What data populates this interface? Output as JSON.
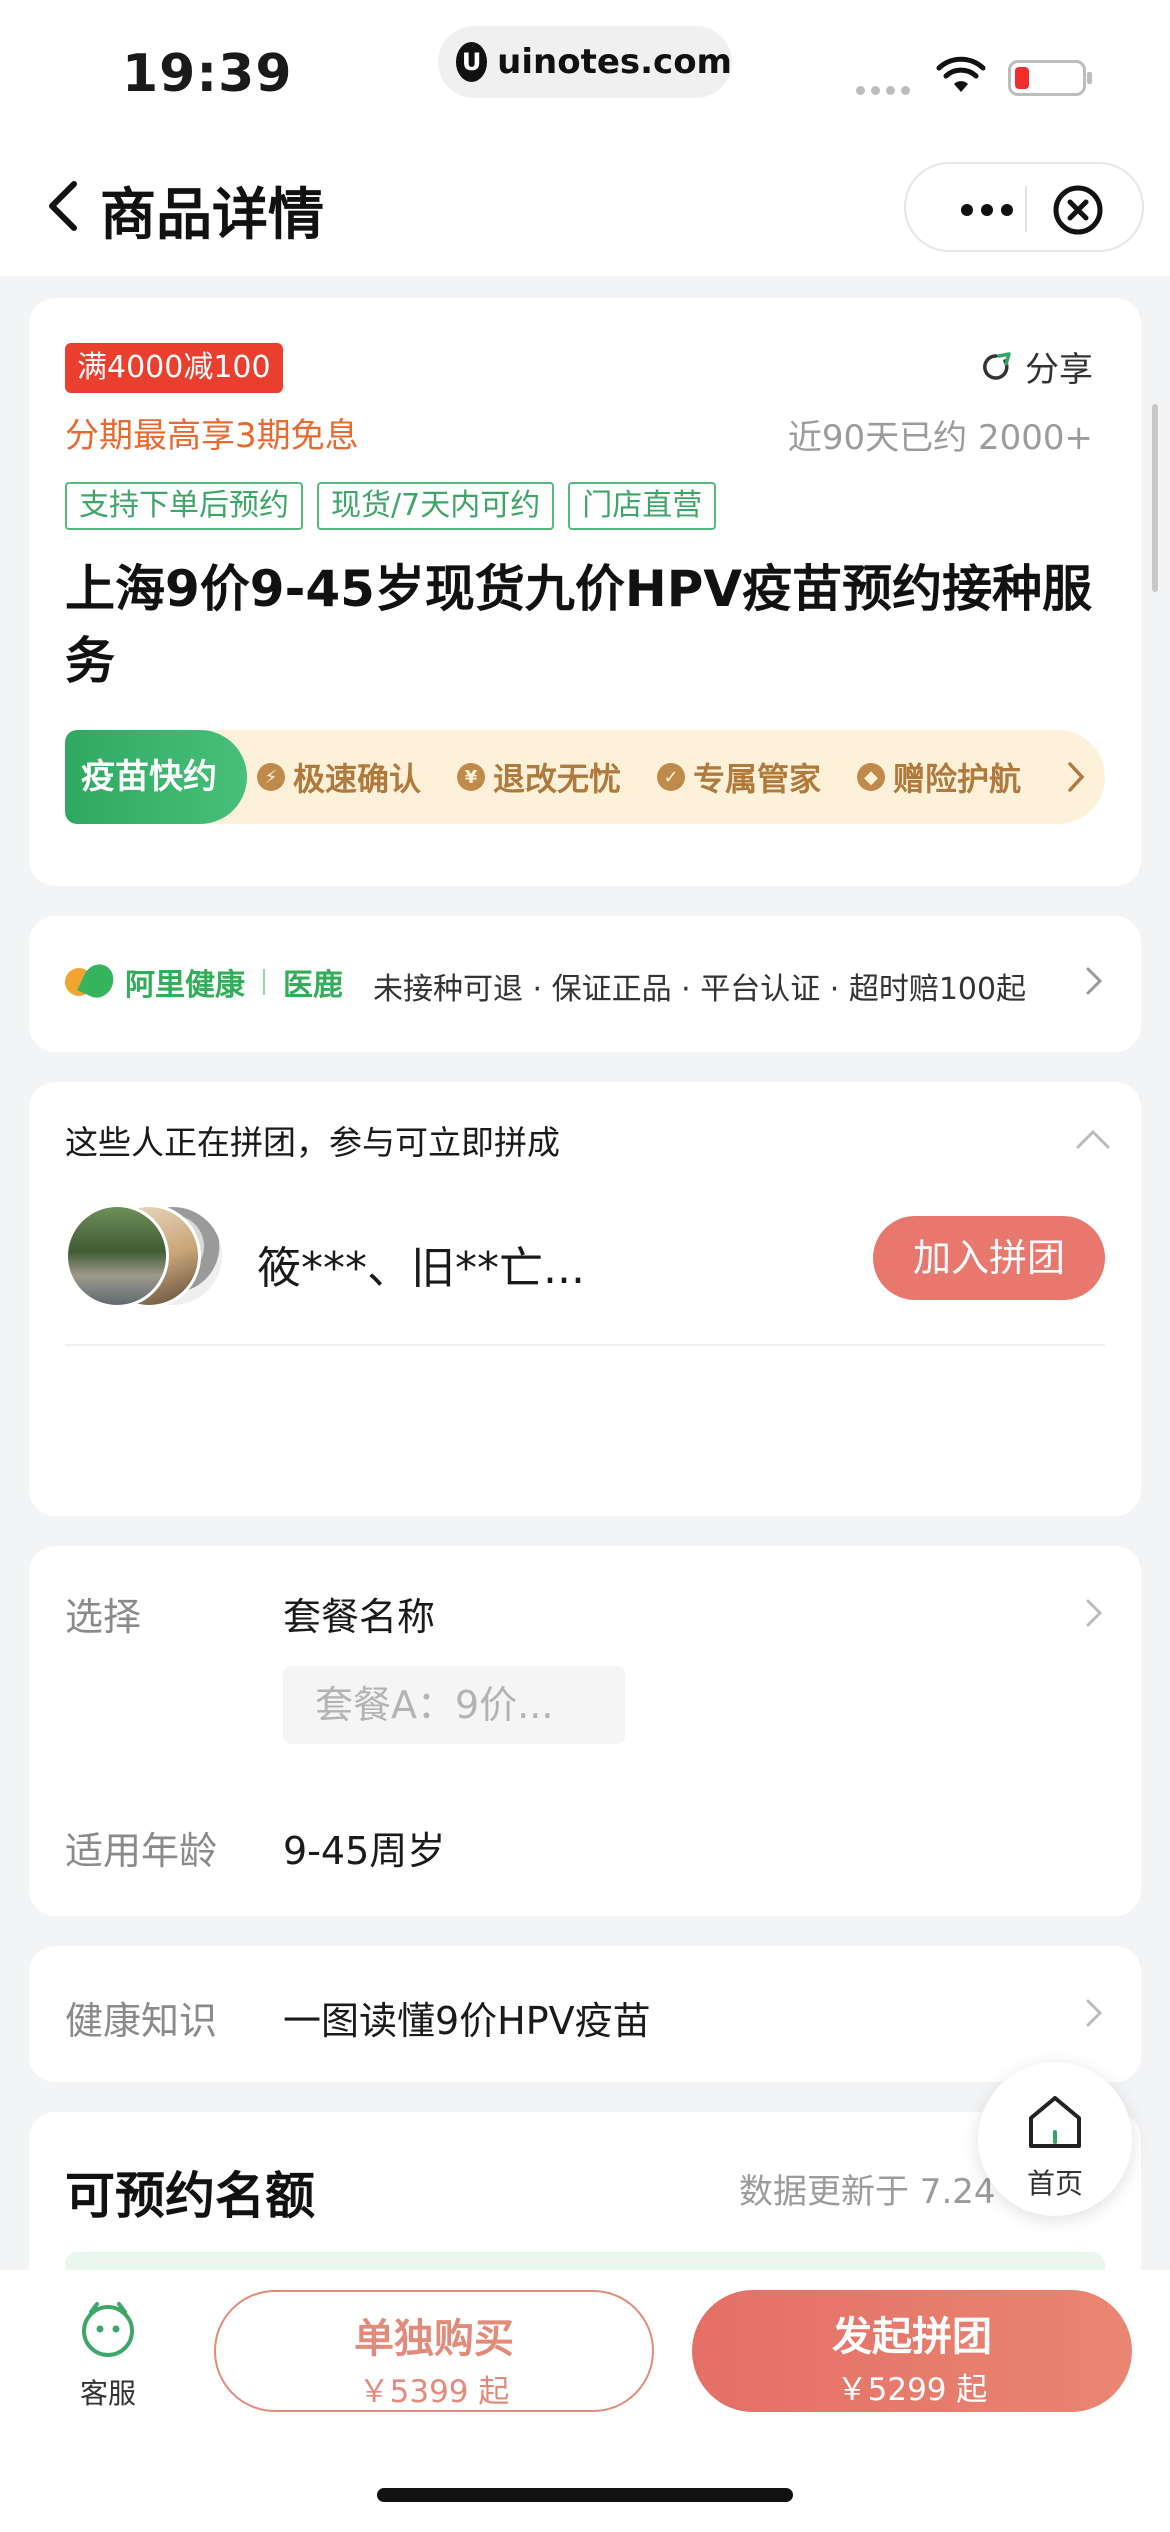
{
  "status_bar": {
    "time": "19:39",
    "url": "uinotes.com",
    "url_logo_glyph": "U"
  },
  "nav": {
    "title": "商品详情",
    "icons": [
      "chevron-left-icon",
      "more-dots-icon",
      "close-circle-icon"
    ]
  },
  "product": {
    "promo_badge": "满4000减100",
    "share_label": "分享",
    "installment": "分期最高享3期免息",
    "sold": "近90天已约 2000+",
    "tags": [
      "支持下单后预约",
      "现货/7天内可约",
      "门店直营"
    ],
    "title": "上海9价9-45岁现货九价HPV疫苗预约接种服务",
    "vaccine_bar": {
      "label": "疫苗快约",
      "features": [
        {
          "icon": "lightning-icon",
          "glyph": "⚡",
          "label": "极速确认"
        },
        {
          "icon": "yen-icon",
          "glyph": "¥",
          "label": "退改无忧"
        },
        {
          "icon": "check-icon",
          "glyph": "✓",
          "label": "专属管家"
        },
        {
          "icon": "shield-icon",
          "glyph": "◆",
          "label": "赠险护航"
        }
      ]
    }
  },
  "health": {
    "brand": "阿里健康",
    "brand_sub": "医鹿",
    "guarantee": "未接种可退 · 保证正品 · 平台认证 · 超时赔100起"
  },
  "group": {
    "title": "这些人正在拼团，参与可立即拼成",
    "members": "筱***、旧**亡...",
    "join_label": "加入拼团"
  },
  "options": {
    "select_label": "选择",
    "package_name": "套餐名称",
    "package_variant": "套餐A：9价...",
    "age_label": "适用年龄",
    "age_value": "9-45周岁"
  },
  "knowledge": {
    "label": "健康知识",
    "value": "一图读懂9价HPV疫苗"
  },
  "quota": {
    "title": "可预约名额",
    "update": "数据更新于 7.24"
  },
  "home_fab": {
    "label": "首页"
  },
  "bottom": {
    "service_label": "客服",
    "buy_label": "单独购买",
    "buy_price": "￥5399 起",
    "group_label": "发起拼团",
    "group_price": "￥5299 起"
  },
  "colors": {
    "accent_red": "#ea3f2f",
    "green": "#3fa669",
    "gold": "#b07a3c",
    "button_coral": "#e8776e"
  }
}
